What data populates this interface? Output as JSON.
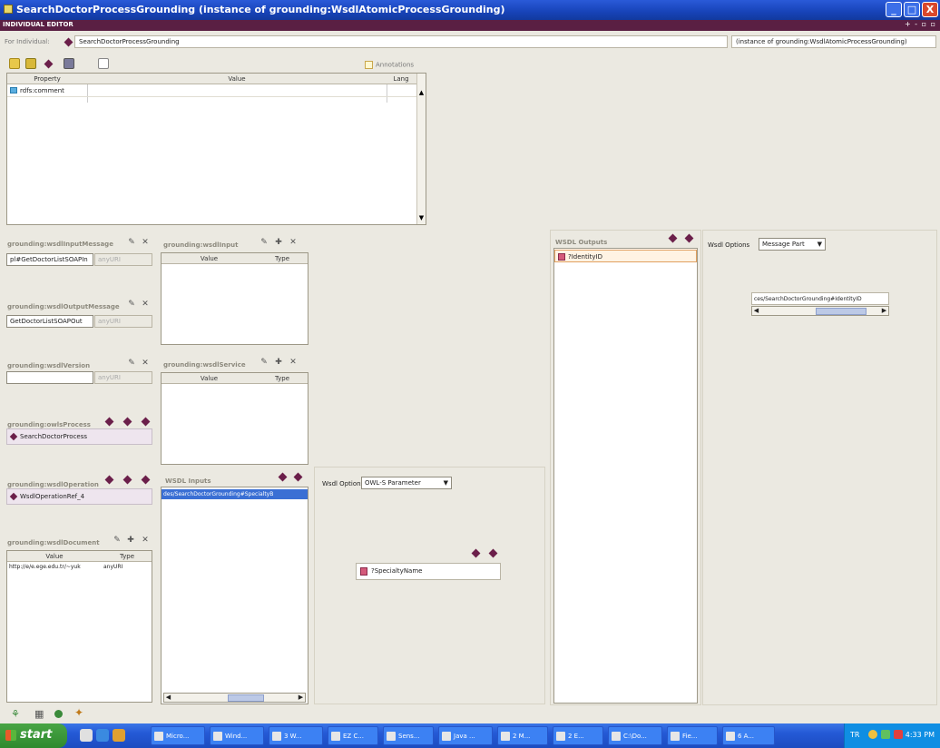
{
  "window": {
    "title": "SearchDoctorProcessGrounding   (instance of grounding:WsdlAtomicProcessGrounding)",
    "min_label": "_",
    "max_label": "□",
    "close_label": "X"
  },
  "editor": {
    "header": "INDIVIDUAL EDITOR",
    "header_controls": "+ - ▫ ▫",
    "for_individual_label": "For Individual:",
    "individual_name": "SearchDoctorProcessGrounding",
    "instance_of": "(instance of grounding:WsdlAtomicProcessGrounding)",
    "annotations_label": "Annotations"
  },
  "property_table": {
    "columns": [
      "Property",
      "Value",
      "Lang"
    ],
    "rows": [
      {
        "property": "rdfs:comment",
        "value": "",
        "lang": ""
      }
    ]
  },
  "panels": {
    "wsdl_input_message": {
      "title": "grounding:wsdlInputMessage",
      "value": "pl#GetDoctorListSOAPIn",
      "type": "anyURI"
    },
    "wsdl_output_message": {
      "title": "grounding:wsdlOutputMessage",
      "value": "GetDoctorListSOAPOut",
      "type": "anyURI"
    },
    "wsdl_version": {
      "title": "grounding:wsdlVersion",
      "value": "",
      "type": "anyURI"
    },
    "owls_process": {
      "title": "grounding:owlsProcess",
      "value": "SearchDoctorProcess"
    },
    "wsdl_operation": {
      "title": "grounding:wsdlOperation",
      "value": "WsdlOperationRef_4"
    },
    "wsdl_document": {
      "title": "grounding:wsdlDocument",
      "columns": [
        "Value",
        "Type"
      ],
      "rows": [
        {
          "value": "http://e/e.ege.edu.tr/~yuk",
          "type": "anyURI"
        }
      ]
    },
    "wsdl_input": {
      "title": "grounding:wsdlInput",
      "columns": [
        "Value",
        "Type"
      ]
    },
    "wsdl_service": {
      "title": "grounding:wsdlService",
      "columns": [
        "Value",
        "Type"
      ]
    },
    "wsdl_inputs": {
      "title": "WSDL Inputs",
      "selected_item": "des/SearchDoctorGrounding#SpecialtyB"
    },
    "wsdl_outputs": {
      "title": "WSDL Outputs",
      "selected_item": "?IdentityID"
    },
    "wsdl_options_input": {
      "label": "Wsdl Options",
      "selected": "OWL-S Parameter",
      "param_box": "?SpecialtyName"
    },
    "wsdl_options_output": {
      "label": "Wsdl Options",
      "selected": "Message Part",
      "message_part": "ces/SearchDoctorGrounding#IdentityID"
    }
  },
  "taskbar": {
    "start_label": "start",
    "buttons": [
      "Micro...",
      "Wind...",
      "3 W...",
      "EZ C...",
      "Sens...",
      "Java ...",
      "2 M...",
      "2 E...",
      "C:\\Do...",
      "Fie...",
      "6 A..."
    ],
    "clock": "4:33 PM",
    "tray_lang": "TR"
  },
  "colors": {
    "titlebar": "#1743b8",
    "editor_header": "#5a1f43",
    "diamond": "#6b1f4a",
    "background": "#ebe9e1",
    "start_button": "#2f8a2d"
  }
}
